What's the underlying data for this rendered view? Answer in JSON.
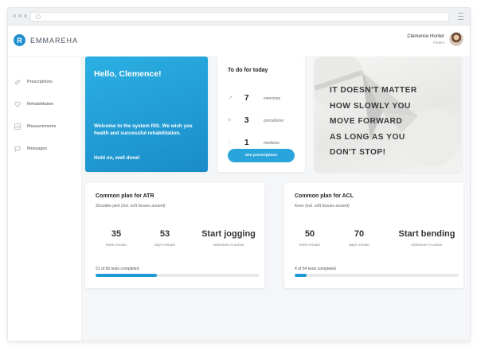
{
  "app": {
    "name": "EMMAREHA",
    "logo_letter": "R",
    "brand_color": "#1f8fd0"
  },
  "user": {
    "name": "Clemence Hunter",
    "role": "Patient"
  },
  "sidebar": {
    "items": [
      {
        "label": "Prescriptions",
        "icon": "pill-icon"
      },
      {
        "label": "Rehabilitation",
        "icon": "heart-icon"
      },
      {
        "label": "Measurements",
        "icon": "chart-icon"
      },
      {
        "label": "Messages",
        "icon": "message-icon"
      }
    ]
  },
  "hello": {
    "title": "Hello, Clemence!",
    "message": "Welcome to the system RIS. We wish you health and successful rehabilitation.",
    "closing": "Hold on, well done!"
  },
  "todo": {
    "title": "To do for today",
    "items": [
      {
        "count": "7",
        "label": "exercises",
        "icon": "exercise-icon"
      },
      {
        "count": "3",
        "label": "procedures",
        "icon": "procedure-icon"
      },
      {
        "count": "1",
        "label": "medicine",
        "icon": "medicine-icon"
      }
    ],
    "button": "See prescriptions"
  },
  "quote": {
    "text": "IT DOESN'T MATTER\nHOW SLOWLY YOU\nMOVE FORWARD\nAS LONG AS YOU\nDON'T STOP!"
  },
  "plans": [
    {
      "title": "Common plan for ATR",
      "subtitle": "Shoulder joint (incl. soft tissues around)",
      "stats": [
        {
          "value": "35",
          "label": "tests remain"
        },
        {
          "value": "53",
          "label": "days remain"
        },
        {
          "value": "Start jogging",
          "label": "milestone is active"
        }
      ],
      "progress_text": "21 of 56 tests completed",
      "progress": 0.375
    },
    {
      "title": "Common plan for ACL",
      "subtitle": "Knee (incl. soft tissues around)",
      "stats": [
        {
          "value": "50",
          "label": "tests remain"
        },
        {
          "value": "70",
          "label": "days remain"
        },
        {
          "value": "Start bending",
          "label": "milestone is active"
        }
      ],
      "progress_text": "4 of 54 tests completed",
      "progress": 0.074
    }
  ]
}
